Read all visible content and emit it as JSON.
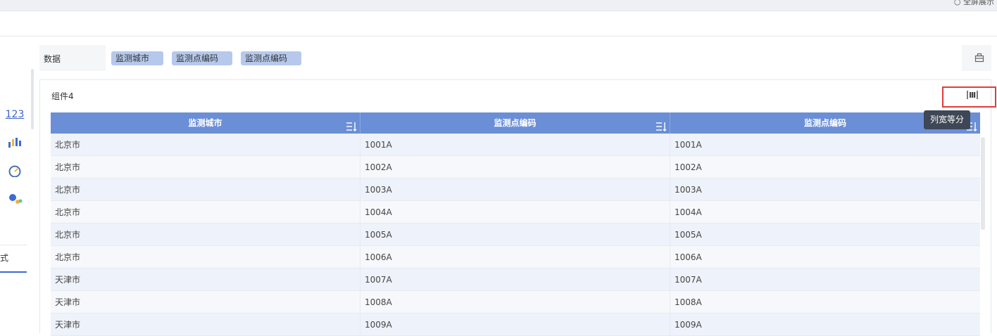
{
  "topbar": {
    "corner_text": "○ 全屏展示"
  },
  "sidebar": {
    "icons": [
      "number-icon",
      "bar-chart-icon",
      "gauge-icon",
      "scatter-icon"
    ],
    "number_label": "123",
    "style_tab_label": "式"
  },
  "data_bar": {
    "label": "数据",
    "fields": [
      "监测城市",
      "监测点编码",
      "监测点编码"
    ]
  },
  "component": {
    "title": "组件4",
    "equal_width_tooltip": "列宽等分"
  },
  "table": {
    "columns": [
      "监测城市",
      "监测点编码",
      "监测点编码"
    ],
    "rows": [
      [
        "北京市",
        "1001A",
        "1001A"
      ],
      [
        "北京市",
        "1002A",
        "1002A"
      ],
      [
        "北京市",
        "1003A",
        "1003A"
      ],
      [
        "北京市",
        "1004A",
        "1004A"
      ],
      [
        "北京市",
        "1005A",
        "1005A"
      ],
      [
        "北京市",
        "1006A",
        "1006A"
      ],
      [
        "天津市",
        "1007A",
        "1007A"
      ],
      [
        "天津市",
        "1008A",
        "1008A"
      ],
      [
        "天津市",
        "1009A",
        "1009A"
      ]
    ]
  },
  "colors": {
    "header_bg": "#6b8fd6",
    "chip_bg": "#b6c9ec",
    "accent": "#3d6bd1",
    "highlight": "#e33b3b"
  }
}
